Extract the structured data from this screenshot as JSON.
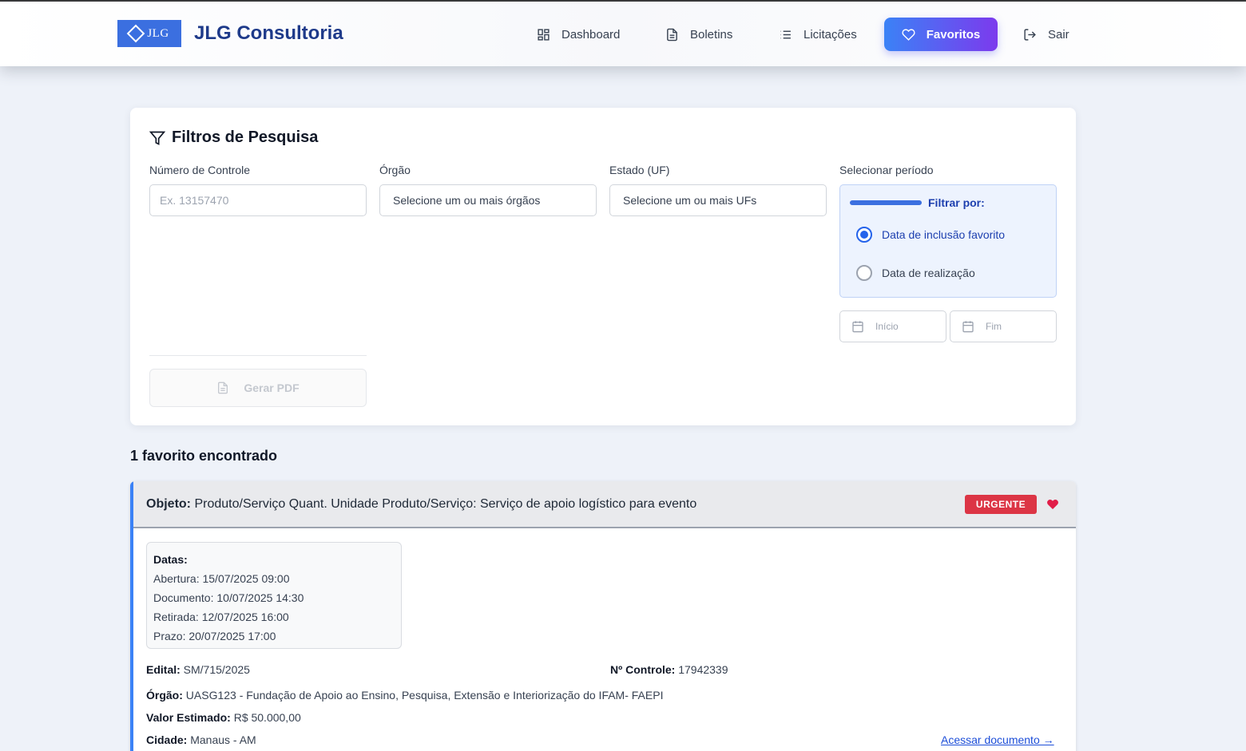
{
  "header": {
    "logo_text": "JLG",
    "brand": "JLG Consultoria",
    "nav": {
      "dashboard": "Dashboard",
      "boletins": "Boletins",
      "licitacoes": "Licitações",
      "favoritos": "Favoritos",
      "sair": "Sair"
    },
    "active": "favoritos"
  },
  "filters": {
    "title": "Filtros de Pesquisa",
    "numero_label": "Número de Controle",
    "numero_placeholder": "Ex. 13157470",
    "orgao_label": "Órgão",
    "orgao_value": "Selecione um ou mais órgãos",
    "uf_label": "Estado (UF)",
    "uf_value": "Selecione um ou mais UFs",
    "periodo_label": "Selecionar período",
    "filtrar_por": "Filtrar por:",
    "radio_inclusao": "Data de inclusão favorito",
    "radio_realizacao": "Data de realização",
    "selected_radio": "inclusao",
    "inicio_placeholder": "Início",
    "fim_placeholder": "Fim",
    "pdf_button": "Gerar PDF"
  },
  "results": {
    "count_text": "1 favorito encontrado"
  },
  "favorite": {
    "objeto_label": "Objeto:",
    "objeto_value": "Produto/Serviço Quant. Unidade Produto/Serviço: Serviço de apoio logístico para evento",
    "badge": "URGENTE",
    "datas_label": "Datas:",
    "abertura_label": "Abertura:",
    "abertura_value": "15/07/2025 09:00",
    "documento_label": "Documento:",
    "documento_value": "10/07/2025 14:30",
    "retirada_label": "Retirada:",
    "retirada_value": "12/07/2025 16:00",
    "prazo_label": "Prazo:",
    "prazo_value": "20/07/2025 17:00",
    "edital_label": "Edital:",
    "edital_value": "SM/715/2025",
    "controle_label": "Nº Controle:",
    "controle_value": "17942339",
    "orgao_label": "Órgão:",
    "orgao_value": "UASG123 - Fundação de Apoio ao Ensino, Pesquisa, Extensão e Interiorização do IFAM- FAEPI",
    "valor_label": "Valor Estimado:",
    "valor_value": "R$ 50.000,00",
    "cidade_label": "Cidade:",
    "cidade_value": "Manaus - AM",
    "link_text": "Acessar documento →"
  },
  "colors": {
    "brand": "#1e3a8a",
    "accent": "#3b82f6",
    "accent_end": "#7c3aed",
    "urgent": "#dc3545"
  }
}
